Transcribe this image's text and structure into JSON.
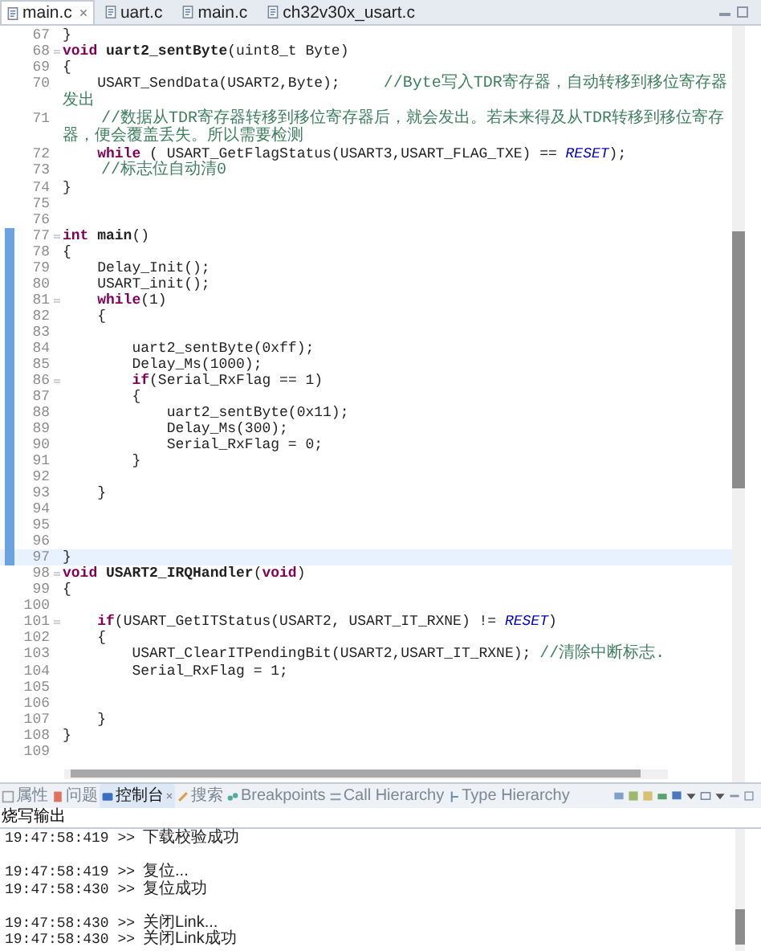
{
  "editor_tabs": [
    {
      "label": "main.c",
      "selected": true
    },
    {
      "label": "uart.c",
      "selected": false
    },
    {
      "label": "main.c",
      "selected": false
    },
    {
      "label": "ch32v30x_usart.c",
      "selected": false
    }
  ],
  "code_lines": [
    {
      "n": "67",
      "fold": false,
      "scope": false,
      "current": false,
      "code": [
        {
          "kind": "plain",
          "text": "}"
        }
      ]
    },
    {
      "n": "68",
      "fold": true,
      "scope": false,
      "current": false,
      "code": [
        {
          "kind": "keyword",
          "text": "void"
        },
        {
          "kind": "name",
          "text": " uart2_sentByte"
        },
        {
          "kind": "plain",
          "text": "(uint8_t Byte)"
        }
      ]
    },
    {
      "n": "69",
      "fold": false,
      "scope": false,
      "current": false,
      "code": [
        {
          "kind": "plain",
          "text": "{"
        }
      ]
    },
    {
      "n": "70",
      "fold": false,
      "scope": false,
      "current": false,
      "code": [
        {
          "kind": "plain",
          "text": "    USART_SendData(USART2,Byte);     "
        },
        {
          "kind": "comment",
          "text": "//Byte写入TDR寄存器，自动转移到移位寄存器发出"
        }
      ]
    },
    {
      "n": "71",
      "fold": false,
      "scope": false,
      "current": false,
      "code": [
        {
          "kind": "comment",
          "text": "    //数据从TDR寄存器转移到移位寄存器后，就会发出。若未来得及从TDR转移到移位寄存器，便会覆盖丢失。所以需要检测"
        }
      ]
    },
    {
      "n": "72",
      "fold": false,
      "scope": false,
      "current": false,
      "code": [
        {
          "kind": "keyword",
          "text": "    while"
        },
        {
          "kind": "plain",
          "text": " ( USART_GetFlagStatus(USART3,USART_FLAG_TXE) == "
        },
        {
          "kind": "constant",
          "text": "RESET"
        },
        {
          "kind": "plain",
          "text": ");"
        }
      ]
    },
    {
      "n": "73",
      "fold": false,
      "scope": false,
      "current": false,
      "code": [
        {
          "kind": "comment",
          "text": "    //标志位自动清0"
        }
      ]
    },
    {
      "n": "74",
      "fold": false,
      "scope": false,
      "current": false,
      "code": [
        {
          "kind": "plain",
          "text": "}"
        }
      ]
    },
    {
      "n": "75",
      "fold": false,
      "scope": false,
      "current": false
    },
    {
      "n": "76",
      "fold": false,
      "scope": false,
      "current": false
    },
    {
      "n": "77",
      "fold": true,
      "scope": true,
      "current": false,
      "code": [
        {
          "kind": "keyword",
          "text": "int"
        },
        {
          "kind": "name",
          "text": " main"
        },
        {
          "kind": "plain",
          "text": "()"
        }
      ]
    },
    {
      "n": "78",
      "fold": false,
      "scope": true,
      "current": false,
      "code": [
        {
          "kind": "plain",
          "text": "{"
        }
      ]
    },
    {
      "n": "79",
      "fold": false,
      "scope": true,
      "current": false,
      "code": [
        {
          "kind": "plain",
          "text": "    Delay_Init();"
        }
      ]
    },
    {
      "n": "80",
      "fold": false,
      "scope": true,
      "current": false,
      "code": [
        {
          "kind": "plain",
          "text": "    USART_init();"
        }
      ]
    },
    {
      "n": "81",
      "fold": true,
      "scope": true,
      "current": false,
      "code": [
        {
          "kind": "keyword",
          "text": "    while"
        },
        {
          "kind": "plain",
          "text": "(1)"
        }
      ]
    },
    {
      "n": "82",
      "fold": false,
      "scope": true,
      "current": false,
      "code": [
        {
          "kind": "plain",
          "text": "    {"
        }
      ]
    },
    {
      "n": "83",
      "fold": false,
      "scope": true,
      "current": false
    },
    {
      "n": "84",
      "fold": false,
      "scope": true,
      "current": false,
      "code": [
        {
          "kind": "plain",
          "text": "        uart2_sentByte(0xff);"
        }
      ]
    },
    {
      "n": "85",
      "fold": false,
      "scope": true,
      "current": false,
      "code": [
        {
          "kind": "plain",
          "text": "        Delay_Ms(1000);"
        }
      ]
    },
    {
      "n": "86",
      "fold": true,
      "scope": true,
      "current": false,
      "code": [
        {
          "kind": "keyword",
          "text": "        if"
        },
        {
          "kind": "plain",
          "text": "(Serial_RxFlag == 1)"
        }
      ]
    },
    {
      "n": "87",
      "fold": false,
      "scope": true,
      "current": false,
      "code": [
        {
          "kind": "plain",
          "text": "        {"
        }
      ]
    },
    {
      "n": "88",
      "fold": false,
      "scope": true,
      "current": false,
      "code": [
        {
          "kind": "plain",
          "text": "            uart2_sentByte(0x11);"
        }
      ]
    },
    {
      "n": "89",
      "fold": false,
      "scope": true,
      "current": false,
      "code": [
        {
          "kind": "plain",
          "text": "            Delay_Ms(300);"
        }
      ]
    },
    {
      "n": "90",
      "fold": false,
      "scope": true,
      "current": false,
      "code": [
        {
          "kind": "plain",
          "text": "            Serial_RxFlag = 0;"
        }
      ]
    },
    {
      "n": "91",
      "fold": false,
      "scope": true,
      "current": false,
      "code": [
        {
          "kind": "plain",
          "text": "        }"
        }
      ]
    },
    {
      "n": "92",
      "fold": false,
      "scope": true,
      "current": false
    },
    {
      "n": "93",
      "fold": false,
      "scope": true,
      "current": false,
      "code": [
        {
          "kind": "plain",
          "text": "    }"
        }
      ]
    },
    {
      "n": "94",
      "fold": false,
      "scope": true,
      "current": false
    },
    {
      "n": "95",
      "fold": false,
      "scope": true,
      "current": false
    },
    {
      "n": "96",
      "fold": false,
      "scope": true,
      "current": false
    },
    {
      "n": "97",
      "fold": false,
      "scope": true,
      "current": true,
      "code": [
        {
          "kind": "plain",
          "text": "}"
        }
      ]
    },
    {
      "n": "98",
      "fold": true,
      "scope": false,
      "current": false,
      "code": [
        {
          "kind": "keyword",
          "text": "void"
        },
        {
          "kind": "name",
          "text": " USART2_IRQHandler"
        },
        {
          "kind": "plain",
          "text": "("
        },
        {
          "kind": "keyword",
          "text": "void"
        },
        {
          "kind": "plain",
          "text": ")"
        }
      ]
    },
    {
      "n": "99",
      "fold": false,
      "scope": false,
      "current": false,
      "code": [
        {
          "kind": "plain",
          "text": "{"
        }
      ]
    },
    {
      "n": "100",
      "fold": false,
      "scope": false,
      "current": false
    },
    {
      "n": "101",
      "fold": true,
      "scope": false,
      "current": false,
      "code": [
        {
          "kind": "keyword",
          "text": "    if"
        },
        {
          "kind": "plain",
          "text": "(USART_GetITStatus(USART2, USART_IT_RXNE) != "
        },
        {
          "kind": "constant",
          "text": "RESET"
        },
        {
          "kind": "plain",
          "text": ")"
        }
      ]
    },
    {
      "n": "102",
      "fold": false,
      "scope": false,
      "current": false,
      "code": [
        {
          "kind": "plain",
          "text": "    {"
        }
      ]
    },
    {
      "n": "103",
      "fold": false,
      "scope": false,
      "current": false,
      "code": [
        {
          "kind": "plain",
          "text": "        USART_ClearITPendingBit(USART2,USART_IT_RXNE); "
        },
        {
          "kind": "comment",
          "text": "//清除中断标志."
        }
      ]
    },
    {
      "n": "104",
      "fold": false,
      "scope": false,
      "current": false,
      "code": [
        {
          "kind": "plain",
          "text": "        Serial_RxFlag = 1;"
        }
      ]
    },
    {
      "n": "105",
      "fold": false,
      "scope": false,
      "current": false
    },
    {
      "n": "106",
      "fold": false,
      "scope": false,
      "current": false
    },
    {
      "n": "107",
      "fold": false,
      "scope": false,
      "current": false,
      "code": [
        {
          "kind": "plain",
          "text": "    }"
        }
      ]
    },
    {
      "n": "108",
      "fold": false,
      "scope": false,
      "current": false,
      "code": [
        {
          "kind": "plain",
          "text": "}"
        }
      ]
    },
    {
      "n": "109",
      "fold": false,
      "scope": false,
      "current": false
    }
  ],
  "panel_tabs": [
    {
      "label": "属性",
      "selected": false
    },
    {
      "label": "问题",
      "selected": false
    },
    {
      "label": "控制台",
      "selected": true
    },
    {
      "label": "搜索",
      "selected": false
    },
    {
      "label": "Breakpoints",
      "selected": false
    },
    {
      "label": "Call Hierarchy",
      "selected": false
    },
    {
      "label": "Type Hierarchy",
      "selected": false
    }
  ],
  "console_title": "烧写输出",
  "console_lines": [
    {
      "kind": "message",
      "time": "19:47:58:419 >>",
      "msg": "下载校验成功"
    },
    {
      "kind": "blank"
    },
    {
      "kind": "message",
      "time": "19:47:58:419 >>",
      "msg": "复位..."
    },
    {
      "kind": "message",
      "time": "19:47:58:430 >>",
      "msg": "复位成功"
    },
    {
      "kind": "blank"
    },
    {
      "kind": "message",
      "time": "19:47:58:430 >>",
      "msg": "关闭Link..."
    },
    {
      "kind": "message",
      "time": "19:47:58:430 >>",
      "msg": "关闭Link成功"
    }
  ]
}
